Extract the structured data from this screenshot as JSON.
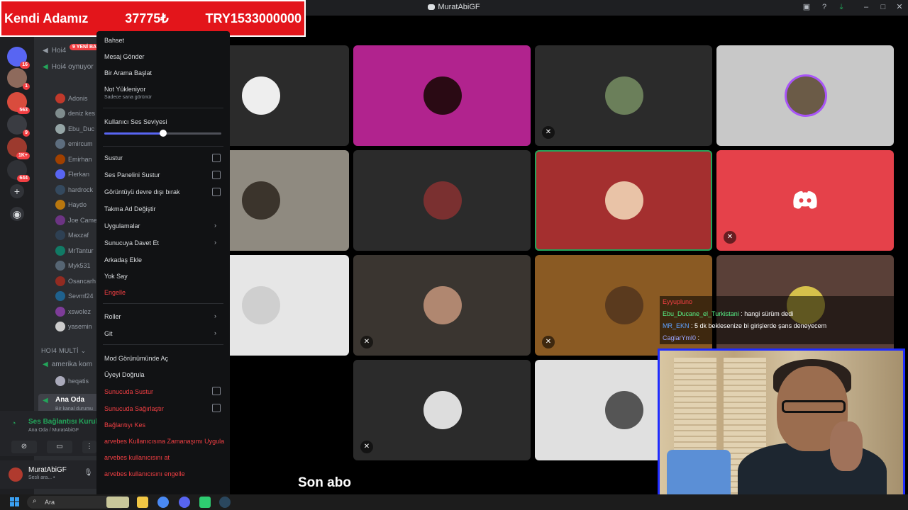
{
  "window": {
    "title": "MuratAbiGF"
  },
  "banner": {
    "name": "Kendi Adamız",
    "price": "37775₺",
    "total": "TRY1533000000"
  },
  "servers": [
    {
      "color": "#5865f2",
      "badge": "16"
    },
    {
      "color": "#8e6a5c",
      "badge": "1"
    },
    {
      "color": "#d94c3d",
      "badge": "563"
    },
    {
      "color": "#3a3c42",
      "badge": "9"
    },
    {
      "color": "#9c3a2e",
      "badge": "1K+"
    },
    {
      "color": "#2f3136",
      "badge": "644"
    }
  ],
  "sidebar": {
    "channels": [
      "Hoi4",
      "Hoi4 oynuyor"
    ],
    "new_badge": "9 YENİ BA",
    "members": [
      {
        "name": "Adonis",
        "color": "#c0392b"
      },
      {
        "name": "deniz kes",
        "color": "#7f8c8d"
      },
      {
        "name": "Ebu_Duc",
        "color": "#95a5a6"
      },
      {
        "name": "emircum",
        "color": "#5d6d7e"
      },
      {
        "name": "Emirhan",
        "color": "#a04000"
      },
      {
        "name": "Flerkan",
        "color": "#5865f2"
      },
      {
        "name": "hardrock",
        "color": "#34495e"
      },
      {
        "name": "Haydo",
        "color": "#b9770e"
      },
      {
        "name": "Joe Came",
        "color": "#6c3483"
      },
      {
        "name": "Maxzaf",
        "color": "#2e4053"
      },
      {
        "name": "MrTantur",
        "color": "#117a65"
      },
      {
        "name": "Myk531",
        "color": "#566573"
      },
      {
        "name": "Osancarh",
        "color": "#922b21"
      },
      {
        "name": "Sevmf24",
        "color": "#1f618d"
      },
      {
        "name": "xswolez",
        "color": "#7d3c98"
      },
      {
        "name": "yasemin",
        "color": "#ccc"
      }
    ],
    "category": "HOI4 MULTİ",
    "channel_amerika": "amerika kom",
    "member_heqatis": "heqatis",
    "active_channel": "Ana Oda",
    "active_desc": "Bir kanal durumu"
  },
  "voice": {
    "status": "Ses Bağlantısı Kuruld",
    "location": "Ana Oda / MuratAbiGF"
  },
  "user": {
    "name": "MuratAbiGF",
    "status": "Sesli ara... • "
  },
  "menu": {
    "bahset": "Bahset",
    "mesaj": "Mesaj Gönder",
    "arama": "Bir Arama Başlat",
    "not": "Not Yükleniyor",
    "not_sub": "Sadece sana görünür",
    "volume_label": "Kullanıcı Ses Seviyesi",
    "volume": 0.5,
    "sustur": "Sustur",
    "ses_paneli": "Ses Panelini Sustur",
    "goruntu": "Görüntüyü devre dışı bırak",
    "takma_ad": "Takma Ad Değiştir",
    "uygulamalar": "Uygulamalar",
    "sunucu_davet": "Sunucuya Davet Et",
    "arkadas": "Arkadaş Ekle",
    "yok_say": "Yok Say",
    "engelle": "Engelle",
    "roller": "Roller",
    "git": "Git",
    "mod": "Mod Görünümünde Aç",
    "uye_dogrula": "Üyeyi Doğrula",
    "sunucu_sustur": "Sunucuda Sustur",
    "sunucu_sagir": "Sunucuda Sağırlaştır",
    "baglanti_kes": "Bağlantıyı Kes",
    "zaman_asimi": "arvebes Kullanıcısına Zamanaşımı Uygula",
    "at": "arvebes kullanıcısını at",
    "engelle_user": "arvebes kullanıcısını engelle"
  },
  "chat": [
    {
      "user": "Eyyupluno",
      "message": "",
      "user_color": "u1"
    },
    {
      "user": "Ebu_Ducane_el_Turkistani",
      "message": " : hangi sürüm dedi",
      "user_color": "u2"
    },
    {
      "user": "MR_EKN",
      "message": " : 5 dk beklesenize bi girişlerde şans deneyecem",
      "user_color": "u3"
    },
    {
      "user": "CaglarYml0",
      "message": " : ",
      "user_color": "u4"
    }
  ],
  "subtitle": "Son abo",
  "taskbar": {
    "search_placeholder": "Ara"
  }
}
